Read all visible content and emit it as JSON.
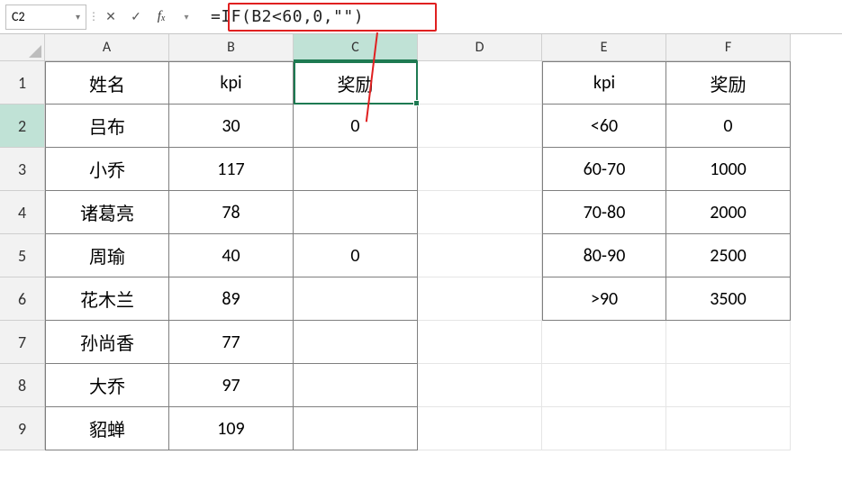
{
  "formula_bar": {
    "name_box": "C2",
    "formula": "=IF(B2<60,0,\"\")"
  },
  "columns": [
    "A",
    "B",
    "C",
    "D",
    "E",
    "F"
  ],
  "rows": [
    "1",
    "2",
    "3",
    "4",
    "5",
    "6",
    "7",
    "8",
    "9"
  ],
  "active_cell": {
    "col": "C",
    "row": 2
  },
  "main_table": {
    "headers": {
      "A": "姓名",
      "B": "kpi",
      "C": "奖励"
    },
    "data": [
      {
        "A": "吕布",
        "B": "30",
        "C": "0"
      },
      {
        "A": "小乔",
        "B": "117",
        "C": ""
      },
      {
        "A": "诸葛亮",
        "B": "78",
        "C": ""
      },
      {
        "A": "周瑜",
        "B": "40",
        "C": "0"
      },
      {
        "A": "花木兰",
        "B": "89",
        "C": ""
      },
      {
        "A": "孙尚香",
        "B": "77",
        "C": ""
      },
      {
        "A": "大乔",
        "B": "97",
        "C": ""
      },
      {
        "A": "貂蝉",
        "B": "109",
        "C": ""
      }
    ]
  },
  "lookup_table": {
    "headers": {
      "E": "kpi",
      "F": "奖励"
    },
    "data": [
      {
        "E": "<60",
        "F": "0"
      },
      {
        "E": "60-70",
        "F": "1000"
      },
      {
        "E": "70-80",
        "F": "2000"
      },
      {
        "E": "80-90",
        "F": "2500"
      },
      {
        "E": ">90",
        "F": "3500"
      }
    ]
  },
  "chart_data": {
    "type": "table",
    "note": "Screenshot depicts two data tables inside an Excel-like grid.",
    "main_table": {
      "columns": [
        "姓名",
        "kpi",
        "奖励"
      ],
      "rows": [
        [
          "吕布",
          30,
          0
        ],
        [
          "小乔",
          117,
          null
        ],
        [
          "诸葛亮",
          78,
          null
        ],
        [
          "周瑜",
          40,
          0
        ],
        [
          "花木兰",
          89,
          null
        ],
        [
          "孙尚香",
          77,
          null
        ],
        [
          "大乔",
          97,
          null
        ],
        [
          "貂蝉",
          109,
          null
        ]
      ]
    },
    "lookup_table": {
      "columns": [
        "kpi",
        "奖励"
      ],
      "rows": [
        [
          "<60",
          0
        ],
        [
          "60-70",
          1000
        ],
        [
          "70-80",
          2000
        ],
        [
          "80-90",
          2500
        ],
        [
          ">90",
          3500
        ]
      ]
    }
  }
}
